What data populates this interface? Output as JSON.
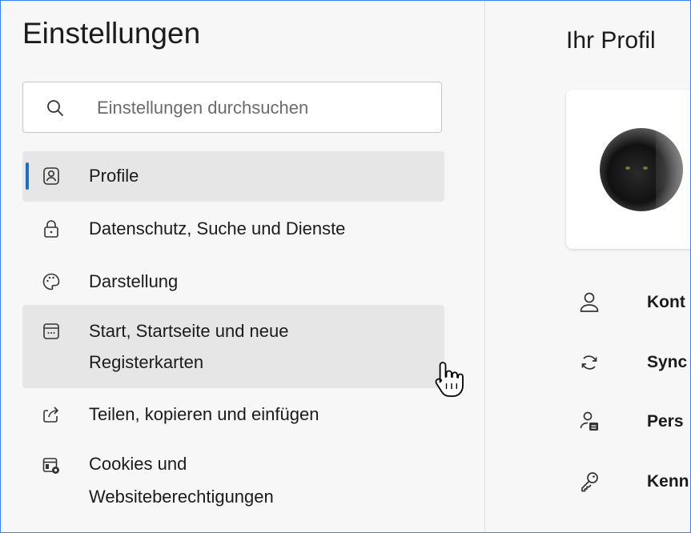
{
  "sidebar": {
    "title": "Einstellungen",
    "search_placeholder": "Einstellungen durchsuchen",
    "items": [
      {
        "label": "Profile",
        "icon": "profile-icon"
      },
      {
        "label": "Datenschutz, Suche und Dienste",
        "icon": "lock-icon"
      },
      {
        "label": "Darstellung",
        "icon": "palette-icon"
      },
      {
        "label_line1": "Start, Startseite und neue",
        "label_line2": "Registerkarten",
        "icon": "start-page-icon"
      },
      {
        "label": "Teilen, kopieren und einfügen",
        "icon": "share-icon"
      },
      {
        "label_line1": "Cookies und",
        "label_line2": "Websiteberechtigungen",
        "icon": "cookies-icon"
      }
    ]
  },
  "main": {
    "title": "Ihr Profil",
    "rows": [
      {
        "label": "Kont",
        "icon": "person-icon"
      },
      {
        "label": "Sync",
        "icon": "sync-icon"
      },
      {
        "label": "Pers",
        "icon": "personal-info-icon"
      },
      {
        "label": "Kenn",
        "icon": "key-icon"
      }
    ]
  },
  "colors": {
    "accent": "#1d6fc4",
    "background": "#f7f7f7",
    "selected": "#e6e6e6"
  }
}
